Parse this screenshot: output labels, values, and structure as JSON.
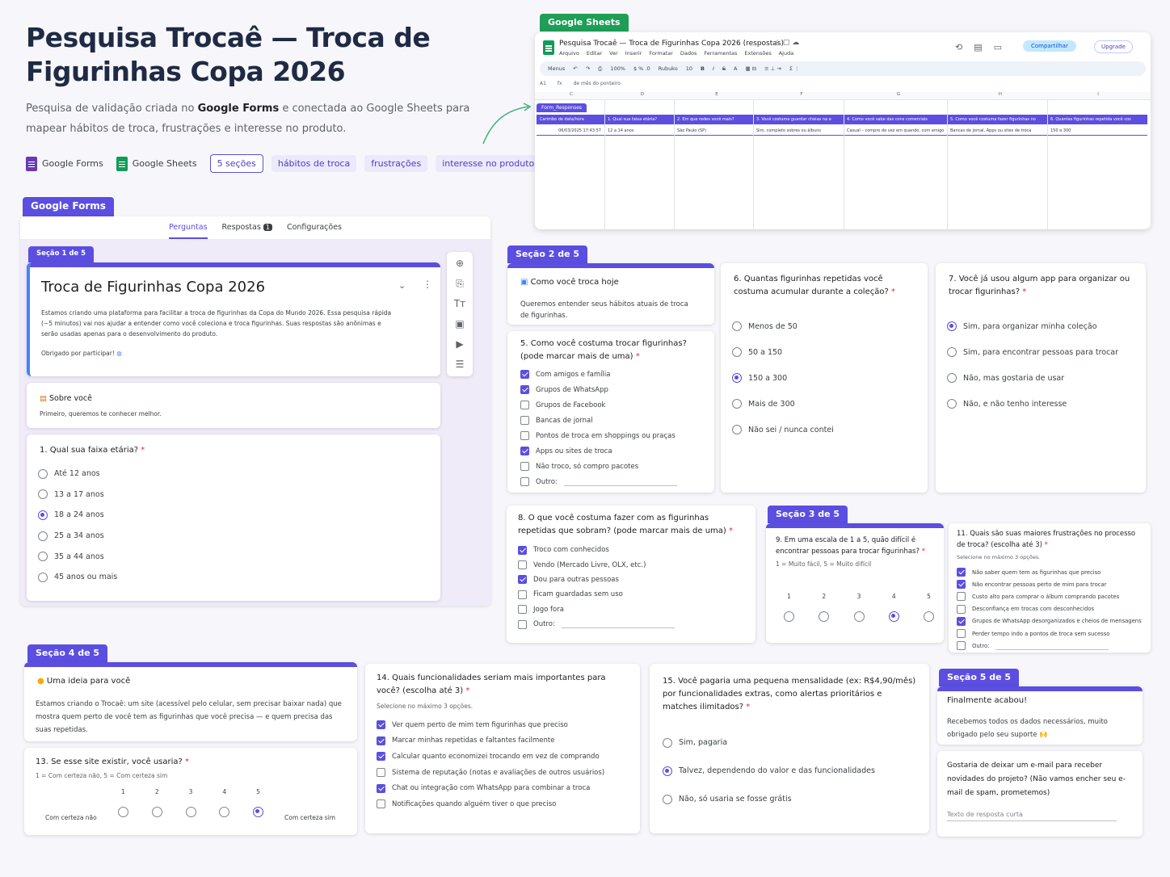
{
  "header": {
    "title": "Pesquisa Trocaê — Troca de Figurinhas Copa 2026",
    "subtitle_pre": "Pesquisa de validação criada no ",
    "subtitle_bold": "Google Forms",
    "subtitle_post": " e conectada ao Google Sheets para mapear hábitos de troca, frustrações e interesse no produto.",
    "chips": {
      "forms": "Google Forms",
      "sheets": "Google Sheets",
      "sections": "5 seções",
      "habits": "hábitos de troca",
      "frustrations": "frustrações",
      "interest": "interesse no produto"
    }
  },
  "sheets": {
    "tag": "Google Sheets",
    "doc_title": "Pesquisa Trocaê — Troca de Figurinhas Copa 2026 (respostas)",
    "menu": [
      "Arquivo",
      "Editar",
      "Ver",
      "Inserir",
      "Formatar",
      "Dados",
      "Ferramentas",
      "Extensões",
      "Ajuda"
    ],
    "share": "Compartilhar",
    "upgrade": "Upgrade",
    "toolbar": {
      "menus": "Menus",
      "zoom": "100%",
      "font": "Rubuko",
      "size": "10"
    },
    "cell_ref": "A1",
    "formula": "de mês do ponteiro",
    "sheet_tab": "Form_Responses",
    "columns": [
      "C",
      "D",
      "E",
      "F",
      "G",
      "H",
      "I",
      "C"
    ],
    "headers": [
      "Carimbo de data/hora",
      "1. Qual sua faixa etária?",
      "2. Em que redes você mais?",
      "3. Você costuma guardar cheias na a",
      "4. Como você sabe das cons comerciais",
      "5. Como você costuma fazer figurinhas no",
      "6. Quantas figurinhas repetida você cos"
    ],
    "row": [
      "06/03/2025 17:43:57",
      "12 a 14 anos",
      "São Paulo (SP)",
      "Sim, completo sobres ou álbuns",
      "Casual – compro de vez em quando, com amigo",
      "Bancas de jornal, Apps ou sites de troca",
      "150 a 300"
    ]
  },
  "forms": {
    "tag": "Google Forms",
    "tabs": {
      "questions": "Perguntas",
      "responses": "Respostas",
      "responses_count": "1",
      "settings": "Configurações"
    },
    "section1_tag": "Seção 1 de 5",
    "form_title": "Troca de Figurinhas Copa 2026",
    "form_desc": "Estamos criando uma plataforma para facilitar a troca de figurinhas da Copa do Mundo 2026. Essa pesquisa rápida (~5 minutos) vai nos ajudar a entender como você coleciona e troca figurinhas. Suas respostas são anônimas e serão usadas apenas para o desenvolvimento do produto.",
    "form_thanks": "Obrigado por participar!",
    "about_title": "Sobre você",
    "about_desc": "Primeiro, queremos te conhecer melhor.",
    "q1": "1. Qual sua faixa etária?",
    "q1_options": [
      "Até 12 anos",
      "13 a 17 anos",
      "18 a 24 anos",
      "25 a 34 anos",
      "35 a 44 anos",
      "45 anos ou mais"
    ],
    "q1_selected": 2
  },
  "section2": {
    "tag": "Seção 2 de 5",
    "title": "Como você troca hoje",
    "desc": "Queremos entender seus hábitos atuais de troca de figurinhas.",
    "q5": "5. Como você costuma trocar figurinhas? (pode marcar mais de uma)",
    "q5_options": [
      {
        "label": "Com amigos e família",
        "checked": true
      },
      {
        "label": "Grupos de WhatsApp",
        "checked": true
      },
      {
        "label": "Grupos de Facebook",
        "checked": false
      },
      {
        "label": "Bancas de jornal",
        "checked": false
      },
      {
        "label": "Pontos de troca em shoppings ou praças",
        "checked": false
      },
      {
        "label": "Apps ou sites de troca",
        "checked": true
      },
      {
        "label": "Não troco, só compro pacotes",
        "checked": false
      },
      {
        "label": "Outro:",
        "checked": false
      }
    ],
    "q6": "6. Quantas figurinhas repetidas você costuma acumular durante a coleção?",
    "q6_options": [
      "Menos de 50",
      "50 a 150",
      "150 a 300",
      "Mais de 300",
      "Não sei / nunca contei"
    ],
    "q6_selected": 2,
    "q7": "7. Você já usou algum app para organizar ou trocar figurinhas?",
    "q7_options": [
      "Sim, para organizar minha coleção",
      "Sim, para encontrar pessoas para trocar",
      "Não, mas gostaria de usar",
      "Não, e não tenho interesse"
    ],
    "q7_selected": 0,
    "q8": "8. O que você costuma fazer com as figurinhas repetidas que sobram? (pode marcar mais de uma)",
    "q8_options": [
      {
        "label": "Troco com conhecidos",
        "checked": true
      },
      {
        "label": "Vendo (Mercado Livre, OLX, etc.)",
        "checked": false
      },
      {
        "label": "Dou para outras pessoas",
        "checked": true
      },
      {
        "label": "Ficam guardadas sem uso",
        "checked": false
      },
      {
        "label": "Jogo fora",
        "checked": false
      },
      {
        "label": "Outro:",
        "checked": false
      }
    ]
  },
  "section3": {
    "tag": "Seção 3 de 5",
    "q9": "9. Em uma escala de 1 a 5, quão difícil é encontrar pessoas para trocar figurinhas?",
    "q9_hint": "1 = Muito fácil, 5 = Muito difícil",
    "q9_scale": [
      "1",
      "2",
      "3",
      "4",
      "5"
    ],
    "q9_selected": 3,
    "q11": "11. Quais são suas maiores frustrações no processo de troca? (escolha até 3)",
    "q11_hint": "Selecione no máximo 3 opções.",
    "q11_options": [
      {
        "label": "Não saber quem tem as figurinhas que preciso",
        "checked": true
      },
      {
        "label": "Não encontrar pessoas perto de mim para trocar",
        "checked": true
      },
      {
        "label": "Custo alto para comprar o álbum comprando pacotes",
        "checked": false
      },
      {
        "label": "Desconfiança em trocas com desconhecidos",
        "checked": false
      },
      {
        "label": "Grupos de WhatsApp desorganizados e cheios de mensagens",
        "checked": true
      },
      {
        "label": "Perder tempo indo a pontos de troca sem sucesso",
        "checked": false
      },
      {
        "label": "Outro:",
        "checked": false
      }
    ]
  },
  "section4": {
    "tag": "Seção 4 de 5",
    "idea_title": "Uma ideia para você",
    "idea_desc": "Estamos criando o Trocaê: um site (acessível pelo celular, sem precisar baixar nada) que mostra quem perto de você tem as figurinhas que você precisa — e quem precisa das suas repetidas.",
    "q13": "13. Se esse site existir, você usaria?",
    "q13_hint": "1 = Com certeza não, 5 = Com certeza sim",
    "q13_low": "Com certeza não",
    "q13_high": "Com certeza sim",
    "q13_scale": [
      "1",
      "2",
      "3",
      "4",
      "5"
    ],
    "q13_selected": 4,
    "q14": "14. Quais funcionalidades seriam mais importantes para você? (escolha até 3)",
    "q14_hint": "Selecione no máximo 3 opções.",
    "q14_options": [
      {
        "label": "Ver quem perto de mim tem figurinhas que preciso",
        "checked": true
      },
      {
        "label": "Marcar minhas repetidas e faltantes facilmente",
        "checked": true
      },
      {
        "label": "Calcular quanto economizei trocando em vez de comprando",
        "checked": true
      },
      {
        "label": "Sistema de reputação (notas e avaliações de outros usuários)",
        "checked": false
      },
      {
        "label": "Chat ou integração com WhatsApp para combinar a troca",
        "checked": true
      },
      {
        "label": "Notificações quando alguém tiver o que preciso",
        "checked": false
      }
    ],
    "q15": "15. Você pagaria uma pequena mensalidade (ex: R$4,90/mês) por funcionalidades extras, como alertas prioritários e matches ilimitados?",
    "q15_options": [
      "Sim, pagaria",
      "Talvez, dependendo do valor e das funcionalidades",
      "Não, só usaria se fosse grátis"
    ],
    "q15_selected": 1
  },
  "section5": {
    "tag": "Seção 5 de 5",
    "end_title": "Finalmente acabou!",
    "end_desc": "Recebemos todos os dados necessários, muito obrigado pelo seu suporte 🙌",
    "email_q": "Gostaria de deixar um e-mail para receber novidades do projeto? (Não vamos encher seu e-mail de spam, prometemos)",
    "email_placeholder": "Texto de resposta curta"
  },
  "colors": {
    "accent": "#5b4ee0",
    "sheets_green": "#1e9e57",
    "required": "#d93025"
  }
}
